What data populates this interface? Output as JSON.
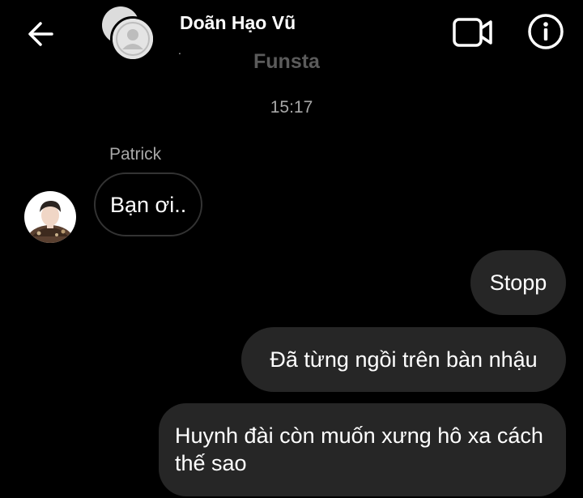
{
  "header": {
    "contact_name": "Doãn Hạo Vũ",
    "status": ".",
    "watermark": "Funsta",
    "back_icon": "arrow-left-icon",
    "video_icon": "video-camera-icon",
    "info_icon": "info-icon"
  },
  "thread": {
    "timestamp": "15:17",
    "incoming": {
      "sender": "Patrick",
      "text": "Bạn ơi.."
    },
    "outgoing": [
      {
        "text": "Stopp"
      },
      {
        "text": "Đã từng ngồi trên bàn nhậu"
      },
      {
        "text": "Huynh đài còn muốn xưng hô xa cách thế sao"
      }
    ]
  },
  "colors": {
    "background": "#000000",
    "outgoing_bubble": "#262626",
    "incoming_border": "#333333",
    "muted_text": "#a8a8a8",
    "watermark": "#5b5b5b"
  }
}
